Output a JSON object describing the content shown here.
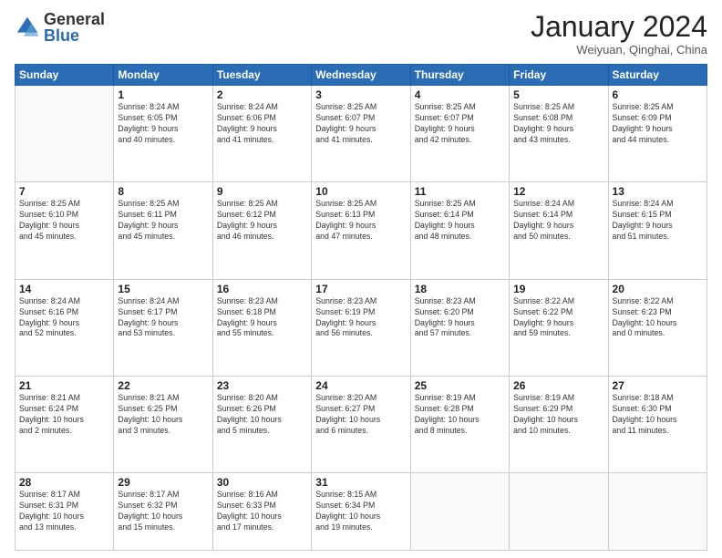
{
  "logo": {
    "general": "General",
    "blue": "Blue"
  },
  "header": {
    "month": "January 2024",
    "location": "Weiyuan, Qinghai, China"
  },
  "weekdays": [
    "Sunday",
    "Monday",
    "Tuesday",
    "Wednesday",
    "Thursday",
    "Friday",
    "Saturday"
  ],
  "weeks": [
    [
      {
        "day": "",
        "info": ""
      },
      {
        "day": "1",
        "info": "Sunrise: 8:24 AM\nSunset: 6:05 PM\nDaylight: 9 hours\nand 40 minutes."
      },
      {
        "day": "2",
        "info": "Sunrise: 8:24 AM\nSunset: 6:06 PM\nDaylight: 9 hours\nand 41 minutes."
      },
      {
        "day": "3",
        "info": "Sunrise: 8:25 AM\nSunset: 6:07 PM\nDaylight: 9 hours\nand 41 minutes."
      },
      {
        "day": "4",
        "info": "Sunrise: 8:25 AM\nSunset: 6:07 PM\nDaylight: 9 hours\nand 42 minutes."
      },
      {
        "day": "5",
        "info": "Sunrise: 8:25 AM\nSunset: 6:08 PM\nDaylight: 9 hours\nand 43 minutes."
      },
      {
        "day": "6",
        "info": "Sunrise: 8:25 AM\nSunset: 6:09 PM\nDaylight: 9 hours\nand 44 minutes."
      }
    ],
    [
      {
        "day": "7",
        "info": "Sunrise: 8:25 AM\nSunset: 6:10 PM\nDaylight: 9 hours\nand 45 minutes."
      },
      {
        "day": "8",
        "info": "Sunrise: 8:25 AM\nSunset: 6:11 PM\nDaylight: 9 hours\nand 45 minutes."
      },
      {
        "day": "9",
        "info": "Sunrise: 8:25 AM\nSunset: 6:12 PM\nDaylight: 9 hours\nand 46 minutes."
      },
      {
        "day": "10",
        "info": "Sunrise: 8:25 AM\nSunset: 6:13 PM\nDaylight: 9 hours\nand 47 minutes."
      },
      {
        "day": "11",
        "info": "Sunrise: 8:25 AM\nSunset: 6:14 PM\nDaylight: 9 hours\nand 48 minutes."
      },
      {
        "day": "12",
        "info": "Sunrise: 8:24 AM\nSunset: 6:14 PM\nDaylight: 9 hours\nand 50 minutes."
      },
      {
        "day": "13",
        "info": "Sunrise: 8:24 AM\nSunset: 6:15 PM\nDaylight: 9 hours\nand 51 minutes."
      }
    ],
    [
      {
        "day": "14",
        "info": "Sunrise: 8:24 AM\nSunset: 6:16 PM\nDaylight: 9 hours\nand 52 minutes."
      },
      {
        "day": "15",
        "info": "Sunrise: 8:24 AM\nSunset: 6:17 PM\nDaylight: 9 hours\nand 53 minutes."
      },
      {
        "day": "16",
        "info": "Sunrise: 8:23 AM\nSunset: 6:18 PM\nDaylight: 9 hours\nand 55 minutes."
      },
      {
        "day": "17",
        "info": "Sunrise: 8:23 AM\nSunset: 6:19 PM\nDaylight: 9 hours\nand 56 minutes."
      },
      {
        "day": "18",
        "info": "Sunrise: 8:23 AM\nSunset: 6:20 PM\nDaylight: 9 hours\nand 57 minutes."
      },
      {
        "day": "19",
        "info": "Sunrise: 8:22 AM\nSunset: 6:22 PM\nDaylight: 9 hours\nand 59 minutes."
      },
      {
        "day": "20",
        "info": "Sunrise: 8:22 AM\nSunset: 6:23 PM\nDaylight: 10 hours\nand 0 minutes."
      }
    ],
    [
      {
        "day": "21",
        "info": "Sunrise: 8:21 AM\nSunset: 6:24 PM\nDaylight: 10 hours\nand 2 minutes."
      },
      {
        "day": "22",
        "info": "Sunrise: 8:21 AM\nSunset: 6:25 PM\nDaylight: 10 hours\nand 3 minutes."
      },
      {
        "day": "23",
        "info": "Sunrise: 8:20 AM\nSunset: 6:26 PM\nDaylight: 10 hours\nand 5 minutes."
      },
      {
        "day": "24",
        "info": "Sunrise: 8:20 AM\nSunset: 6:27 PM\nDaylight: 10 hours\nand 6 minutes."
      },
      {
        "day": "25",
        "info": "Sunrise: 8:19 AM\nSunset: 6:28 PM\nDaylight: 10 hours\nand 8 minutes."
      },
      {
        "day": "26",
        "info": "Sunrise: 8:19 AM\nSunset: 6:29 PM\nDaylight: 10 hours\nand 10 minutes."
      },
      {
        "day": "27",
        "info": "Sunrise: 8:18 AM\nSunset: 6:30 PM\nDaylight: 10 hours\nand 11 minutes."
      }
    ],
    [
      {
        "day": "28",
        "info": "Sunrise: 8:17 AM\nSunset: 6:31 PM\nDaylight: 10 hours\nand 13 minutes."
      },
      {
        "day": "29",
        "info": "Sunrise: 8:17 AM\nSunset: 6:32 PM\nDaylight: 10 hours\nand 15 minutes."
      },
      {
        "day": "30",
        "info": "Sunrise: 8:16 AM\nSunset: 6:33 PM\nDaylight: 10 hours\nand 17 minutes."
      },
      {
        "day": "31",
        "info": "Sunrise: 8:15 AM\nSunset: 6:34 PM\nDaylight: 10 hours\nand 19 minutes."
      },
      {
        "day": "",
        "info": ""
      },
      {
        "day": "",
        "info": ""
      },
      {
        "day": "",
        "info": ""
      }
    ]
  ]
}
